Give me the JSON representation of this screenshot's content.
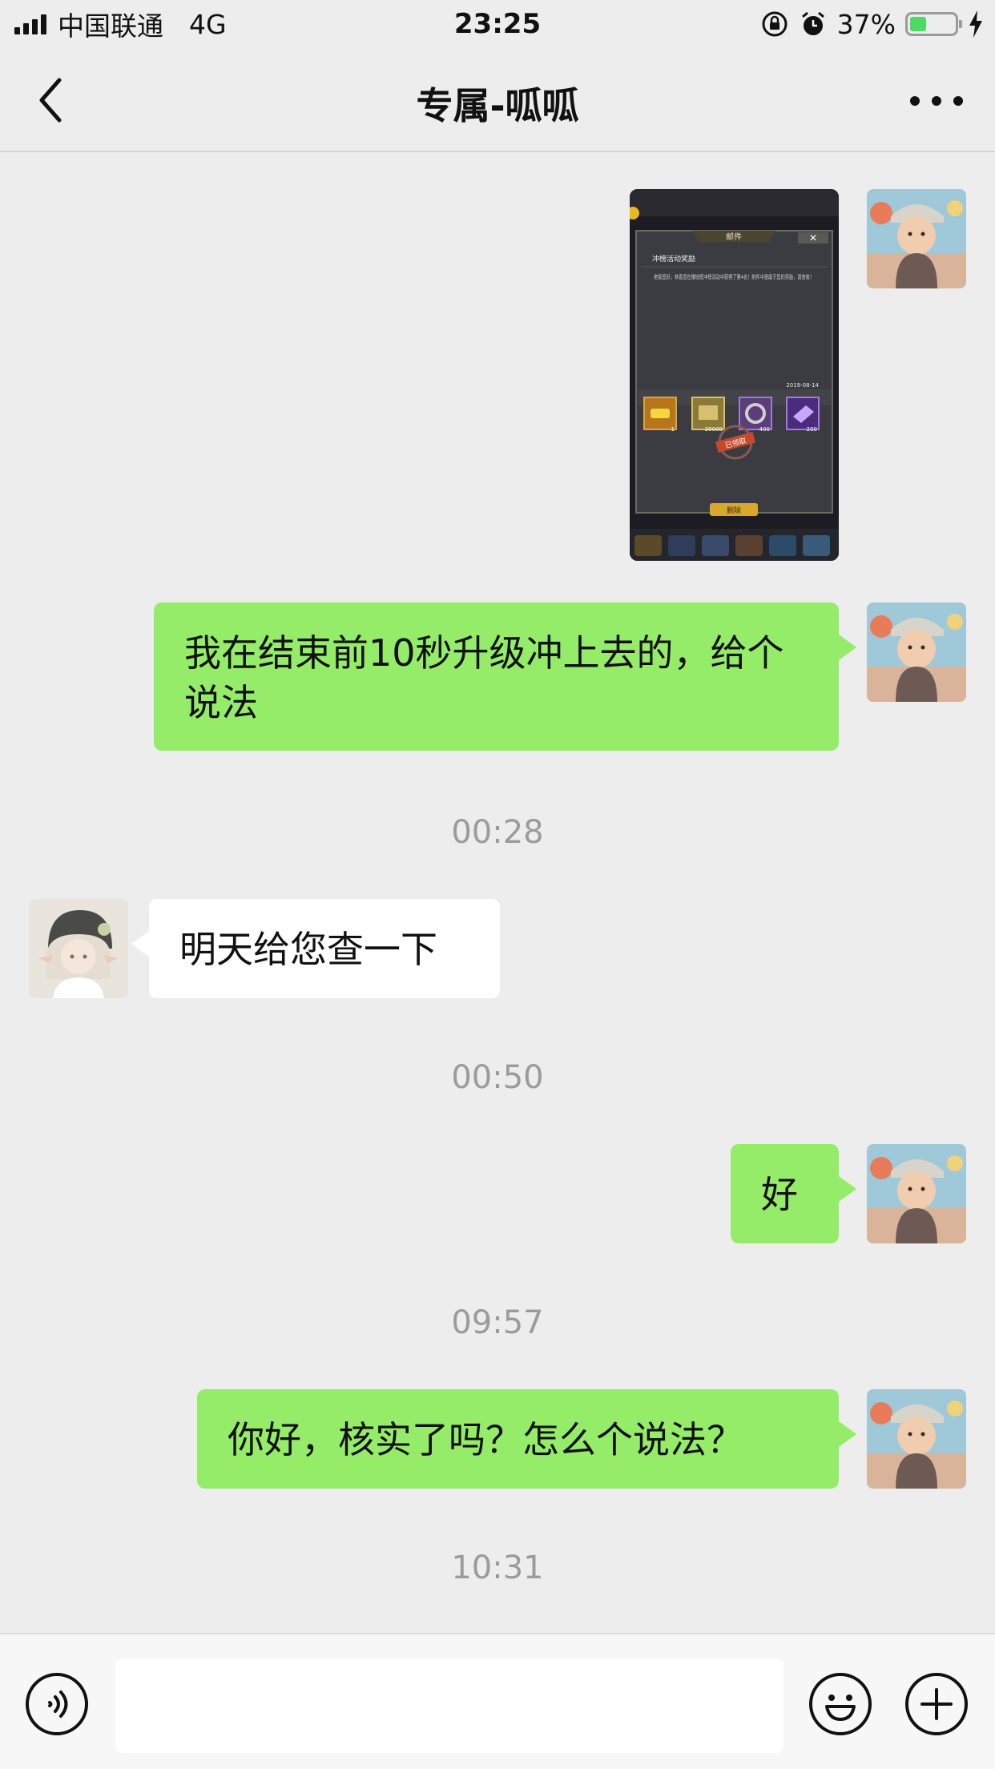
{
  "status_bar": {
    "carrier": "中国联通",
    "network": "4G",
    "time": "23:25",
    "battery": "37%",
    "battery_level": 0.37
  },
  "nav": {
    "title": "专属-呱呱",
    "back_icon": "chevron-left-icon",
    "more_icon": "more-dots-icon"
  },
  "screenshot_content": {
    "header": "邮件",
    "subject": "冲榜活动奖励",
    "body": "老板您好，恭喜您在赚钱榜冲榜活动中获得了第4名！附件中是属于您的奖励，请查收！",
    "date": "2019-08-14",
    "items": [
      "1",
      "20000",
      "400",
      "200"
    ],
    "stamp": "已领取",
    "button": "删除"
  },
  "messages": {
    "m1_text": "我在结束前10秒升级冲上去的，给个说法",
    "ts1": "00:28",
    "m2_text": "明天给您查一下",
    "ts2": "00:50",
    "m3_text": "好",
    "ts3": "09:57",
    "m4_text": "你好，核实了吗？怎么个说法？",
    "ts4": "10:31"
  },
  "input_bar": {
    "voice_icon": "voice-icon",
    "input_value": "",
    "emoji_icon": "emoji-icon",
    "plus_icon": "plus-icon"
  },
  "colors": {
    "background": "#ededed",
    "my_bubble": "#95ec69",
    "other_bubble": "#ffffff",
    "timestamp": "#9b9b9b"
  }
}
